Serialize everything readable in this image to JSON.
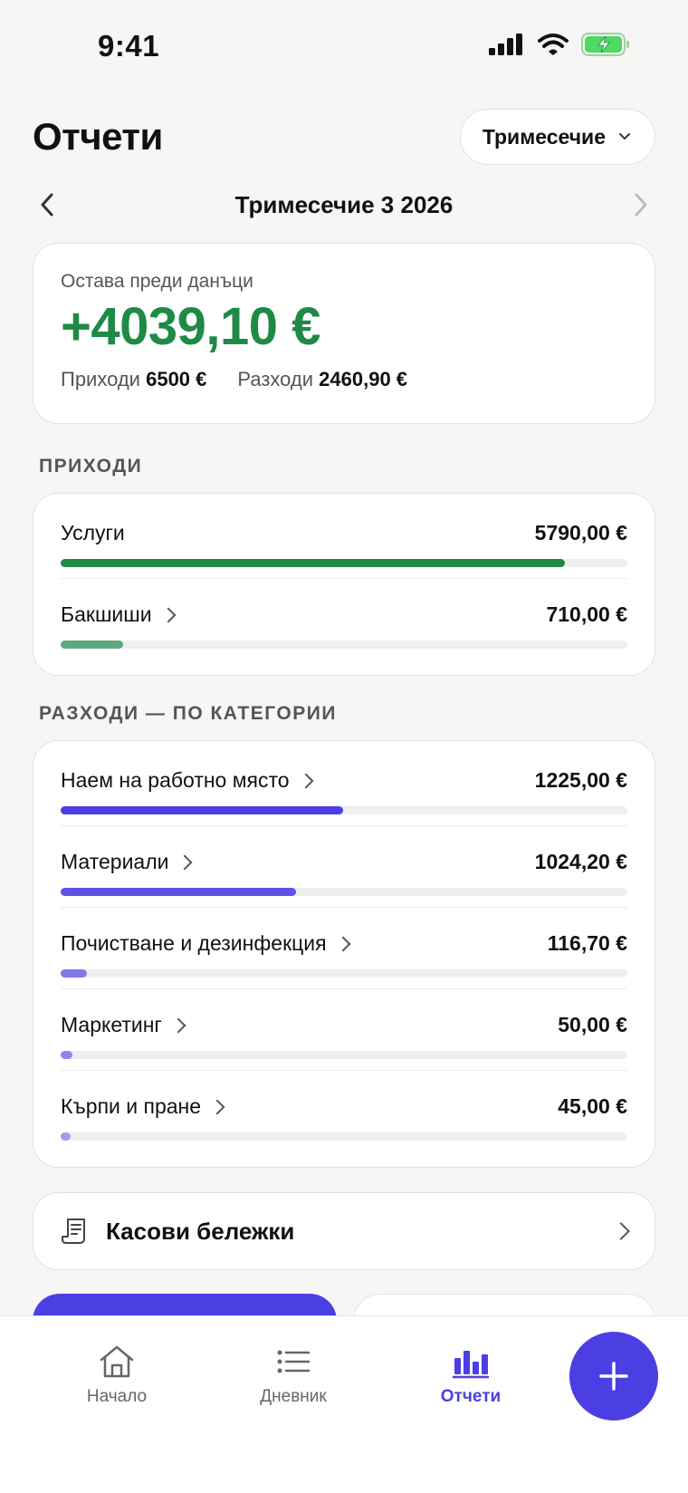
{
  "status": {
    "time": "9:41"
  },
  "header": {
    "title": "Отчети",
    "period_select": "Тримесечие"
  },
  "period_nav": {
    "label": "Тримесечие 3 2026"
  },
  "summary": {
    "caption": "Остава преди данъци",
    "value": "+4039,10 €",
    "income_label": "Приходи",
    "income_value": "6500 €",
    "expense_label": "Разходи",
    "expense_value": "2460,90 €"
  },
  "income_section": {
    "title": "ПРИХОДИ",
    "items": [
      {
        "name": "Услуги",
        "amount": "5790,00 €",
        "fraction": 0.89,
        "color": "#1e8a46",
        "chevron": false
      },
      {
        "name": "Бакшиши",
        "amount": "710,00 €",
        "fraction": 0.11,
        "color": "#5fa77c",
        "chevron": true
      }
    ]
  },
  "expense_section": {
    "title": "РАЗХОДИ — ПО КАТЕГОРИИ",
    "items": [
      {
        "name": "Наем на работно място",
        "amount": "1225,00 €",
        "fraction": 0.498,
        "color": "#4b3fe3"
      },
      {
        "name": "Материали",
        "amount": "1024,20 €",
        "fraction": 0.416,
        "color": "#5d52e5"
      },
      {
        "name": "Почистване и дезинфекция",
        "amount": "116,70 €",
        "fraction": 0.047,
        "color": "#7f77ea"
      },
      {
        "name": "Маркетинг",
        "amount": "50,00 €",
        "fraction": 0.02,
        "color": "#8d86ec"
      },
      {
        "name": "Кърпи и пране",
        "amount": "45,00 €",
        "fraction": 0.018,
        "color": "#a19bf0"
      }
    ]
  },
  "receipts": {
    "label": "Касови бележки",
    "icon": "receipt-icon"
  },
  "tabs": [
    {
      "label": "Начало",
      "icon": "home-icon"
    },
    {
      "label": "Дневник",
      "icon": "list-icon"
    },
    {
      "label": "Отчети",
      "icon": "bar-chart-icon",
      "active": true
    }
  ],
  "fab": {
    "icon": "plus-icon"
  },
  "colors": {
    "accent": "#4b3fe3",
    "positive": "#1e8a46"
  }
}
